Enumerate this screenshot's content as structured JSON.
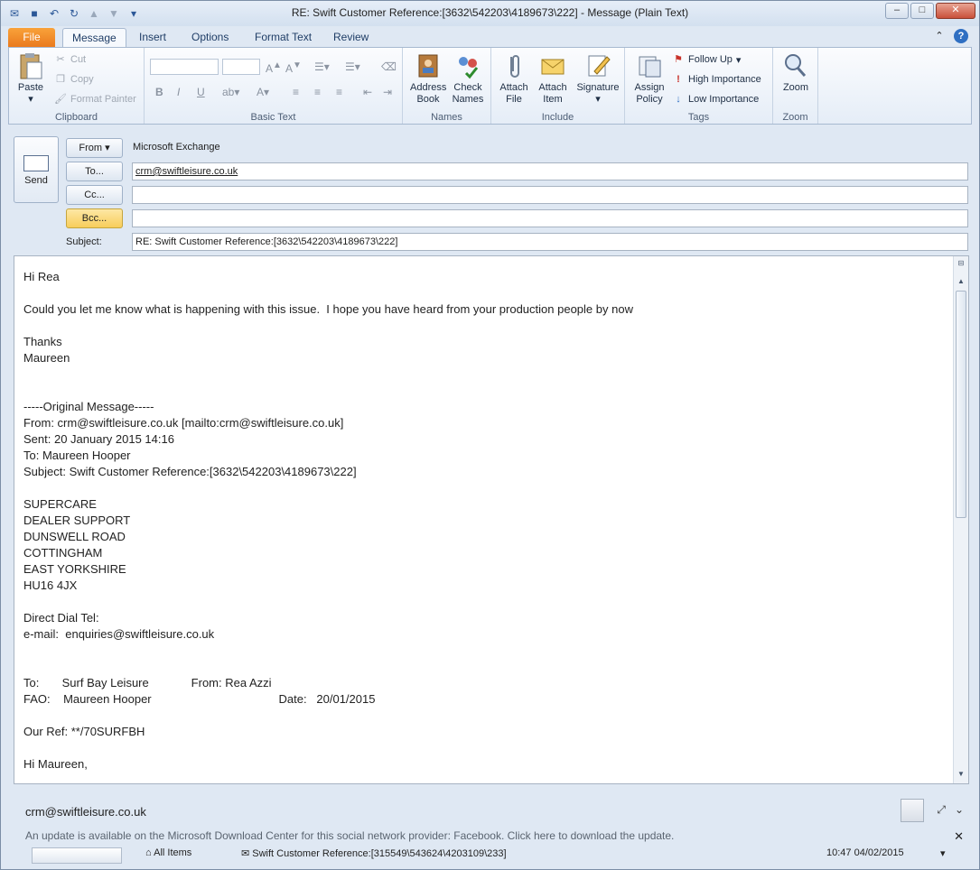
{
  "window": {
    "title": "RE: Swift Customer Reference:[3632\\542203\\4189673\\222]  -  Message (Plain Text)"
  },
  "tabs": [
    "File",
    "Message",
    "Insert",
    "Options",
    "Format Text",
    "Review"
  ],
  "ribbon": {
    "clipboard": {
      "paste": "Paste",
      "cut": "Cut",
      "copy": "Copy",
      "format_painter": "Format Painter",
      "label": "Clipboard"
    },
    "basic_text": {
      "label": "Basic Text"
    },
    "names": {
      "address_book": "Address Book",
      "check_names": "Check Names",
      "label": "Names"
    },
    "include": {
      "attach_file": "Attach File",
      "attach_item": "Attach Item",
      "signature": "Signature",
      "label": "Include"
    },
    "tags": {
      "assign_policy": "Assign Policy",
      "follow_up": "Follow Up",
      "high_importance": "High Importance",
      "low_importance": "Low Importance",
      "label": "Tags"
    },
    "zoom": {
      "zoom": "Zoom",
      "label": "Zoom"
    }
  },
  "compose": {
    "send": "Send",
    "from_btn": "From",
    "from_value": "Microsoft Exchange",
    "to_btn": "To...",
    "to_value": "crm@swiftleisure.co.uk",
    "cc_btn": "Cc...",
    "bcc_btn": "Bcc...",
    "subject_label": "Subject:",
    "subject_value": "RE: Swift Customer Reference:[3632\\542203\\4189673\\222]"
  },
  "body_lines": [
    "Hi Rea",
    "",
    "Could you let me know what is happening with this issue.  I hope you have heard from your production people by now",
    "",
    "Thanks",
    "Maureen",
    "",
    "",
    "-----Original Message-----",
    "From: crm@swiftleisure.co.uk [mailto:crm@swiftleisure.co.uk]",
    "Sent: 20 January 2015 14:16",
    "To: Maureen Hooper",
    "Subject: Swift Customer Reference:[3632\\542203\\4189673\\222]",
    "",
    "SUPERCARE",
    "DEALER SUPPORT",
    "DUNSWELL ROAD",
    "COTTINGHAM",
    "EAST YORKSHIRE",
    "HU16 4JX",
    "",
    "Direct Dial Tel:",
    "e-mail:  enquiries@swiftleisure.co.uk",
    "",
    "",
    "To:       Surf Bay Leisure             From: Rea Azzi",
    "FAO:    Maureen Hooper                                       Date:   20/01/2015",
    "",
    "Our Ref: **/70SURFBH",
    "",
    "Hi Maureen,"
  ],
  "people_pane": {
    "sender": "crm@swiftleisure.co.uk",
    "notice": "An update is available on the Microsoft Download Center for this social network provider: Facebook. Click here to download the update.",
    "feed_filter": "All Items",
    "feed_item": "Swift Customer Reference:[315549\\543624\\4203109\\233]",
    "feed_time": "10:47  04/02/2015"
  }
}
